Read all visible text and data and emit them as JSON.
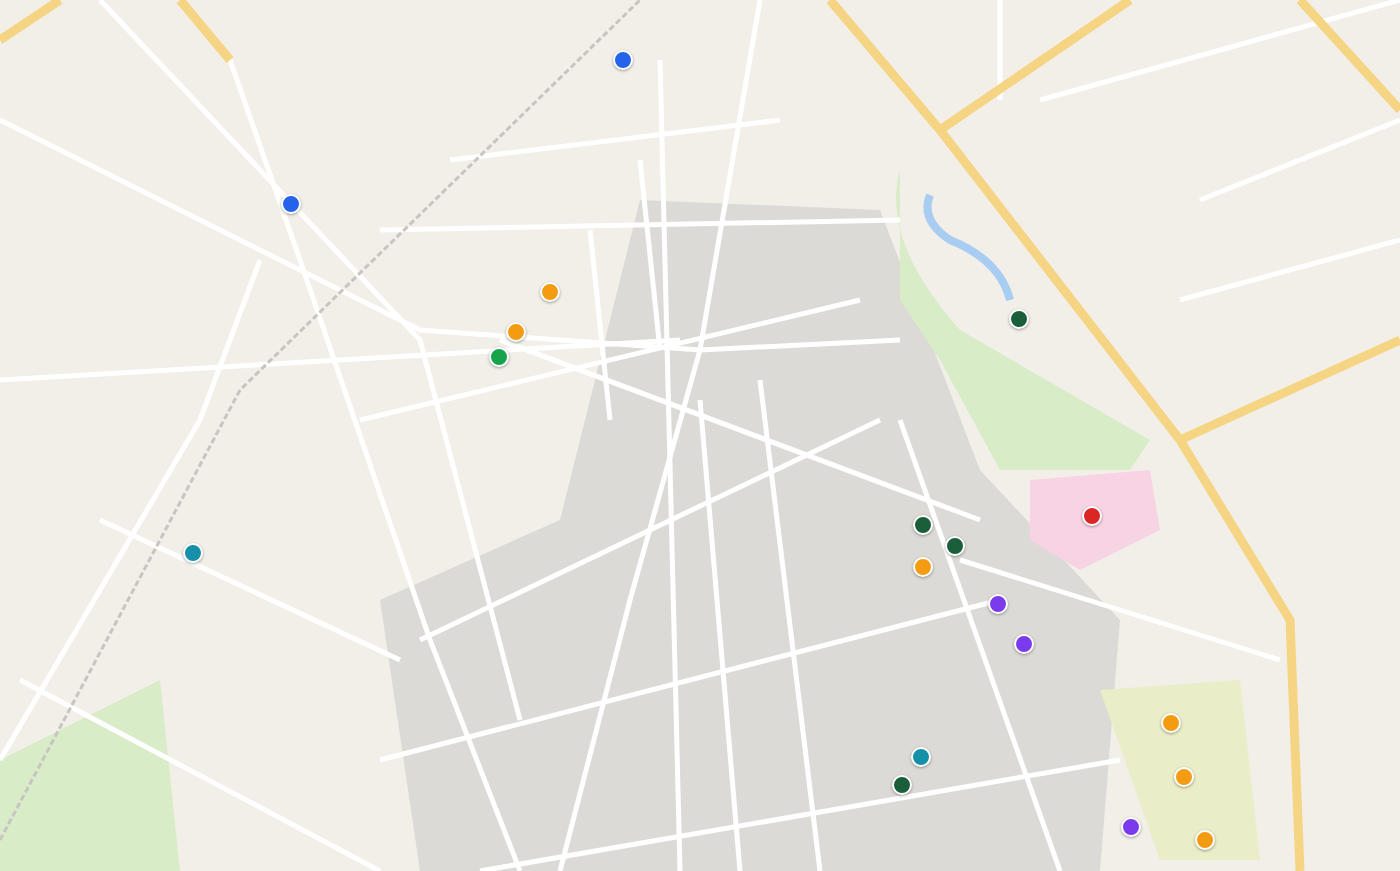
{
  "map": {
    "markers": [
      {
        "color": "#2563eb"
      },
      {
        "color": "#2563eb"
      },
      {
        "color": "#f39c12"
      },
      {
        "color": "#f39c12"
      },
      {
        "color": "#16a34a"
      },
      {
        "color": "#1b5e3a"
      },
      {
        "color": "#dc2626"
      },
      {
        "color": "#1b5e3a"
      },
      {
        "color": "#1b5e3a"
      },
      {
        "color": "#f39c12"
      },
      {
        "color": "#7c3aed"
      },
      {
        "color": "#7c3aed"
      },
      {
        "color": "#1690a8"
      },
      {
        "color": "#f39c12"
      },
      {
        "color": "#f39c12"
      },
      {
        "color": "#1690a8"
      },
      {
        "color": "#1b5e3a"
      },
      {
        "color": "#7c3aed"
      },
      {
        "color": "#f39c12"
      }
    ]
  }
}
